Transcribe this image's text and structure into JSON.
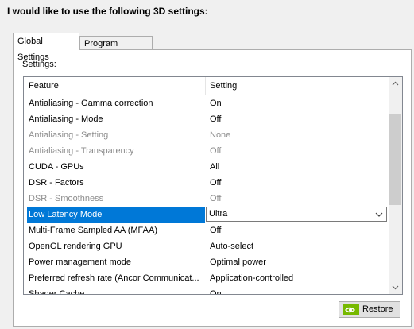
{
  "heading": "I would like to use the following 3D settings:",
  "tabs": [
    {
      "label": "Global Settings",
      "active": true
    },
    {
      "label": "Program Settings",
      "active": false
    }
  ],
  "settings_label": "Settings:",
  "list": {
    "columns": {
      "feature": "Feature",
      "setting": "Setting"
    },
    "rows": [
      {
        "feature": "Antialiasing - Gamma correction",
        "setting": "On",
        "disabled": false
      },
      {
        "feature": "Antialiasing - Mode",
        "setting": "Off",
        "disabled": false
      },
      {
        "feature": "Antialiasing - Setting",
        "setting": "None",
        "disabled": true
      },
      {
        "feature": "Antialiasing - Transparency",
        "setting": "Off",
        "disabled": true
      },
      {
        "feature": "CUDA - GPUs",
        "setting": "All",
        "disabled": false
      },
      {
        "feature": "DSR - Factors",
        "setting": "Off",
        "disabled": false
      },
      {
        "feature": "DSR - Smoothness",
        "setting": "Off",
        "disabled": true
      },
      {
        "feature": "Low Latency Mode",
        "setting": "Ultra",
        "disabled": false,
        "selected": true
      },
      {
        "feature": "Multi-Frame Sampled AA (MFAA)",
        "setting": "Off",
        "disabled": false
      },
      {
        "feature": "OpenGL rendering GPU",
        "setting": "Auto-select",
        "disabled": false
      },
      {
        "feature": "Power management mode",
        "setting": "Optimal power",
        "disabled": false
      },
      {
        "feature": "Preferred refresh rate (Ancor Communicat...",
        "setting": "Application-controlled",
        "disabled": false
      },
      {
        "feature": "Shader Cache",
        "setting": "On",
        "disabled": false
      }
    ]
  },
  "restore_button": "Restore",
  "colors": {
    "selection": "#0078d7",
    "nvidia_green": "#76b900"
  }
}
